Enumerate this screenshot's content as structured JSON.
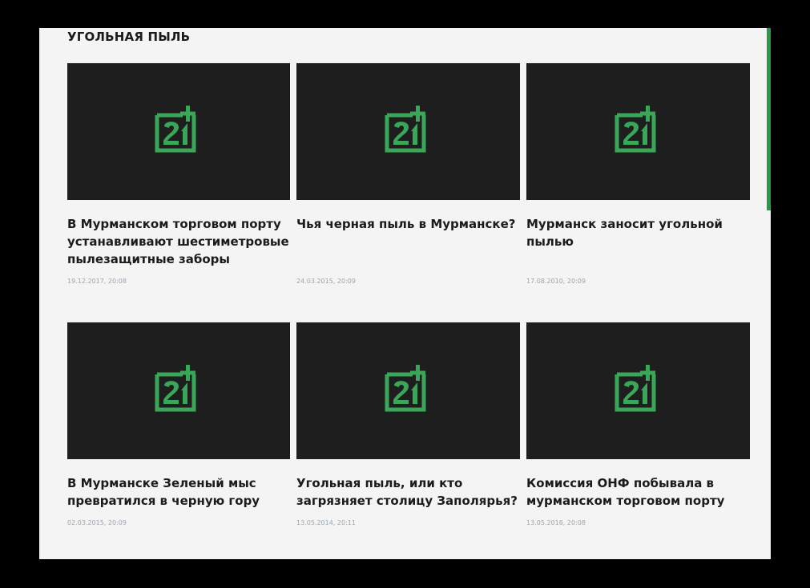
{
  "section": {
    "title": "УГОЛЬНАЯ ПЫЛЬ"
  },
  "colors": {
    "background": "#000000",
    "panel": "#f4f4f4",
    "thumbnail": "#1e1e1e",
    "accent": "#2a9a48",
    "logo": "#3aa65a",
    "title_text": "#1b1b1b",
    "date_text": "#9aa4ae"
  },
  "thumbnail_icon": "channel-21-logo-icon",
  "articles": [
    {
      "title": "В Мурманском торговом порту\nустанавливают шестиметровые\nпылезащитные заборы",
      "date": "19.12.2017, 20:08"
    },
    {
      "title": "Чья черная пыль в Мурманске?",
      "date": "24.03.2015, 20:09"
    },
    {
      "title": "Мурманск заносит угольной\nпылью",
      "date": "17.08.2010, 20:09"
    },
    {
      "title": "В Мурманске Зеленый мыс\nпревратился в черную гору",
      "date": "02.03.2015, 20:09"
    },
    {
      "title": "Угольная пыль, или кто\nзагрязняет столицу Заполярья?",
      "date": "13.05.2014, 20:11"
    },
    {
      "title": "Комиссия ОНФ побывала в\nмурманском торговом порту",
      "date": "13.05.2016, 20:08"
    }
  ]
}
